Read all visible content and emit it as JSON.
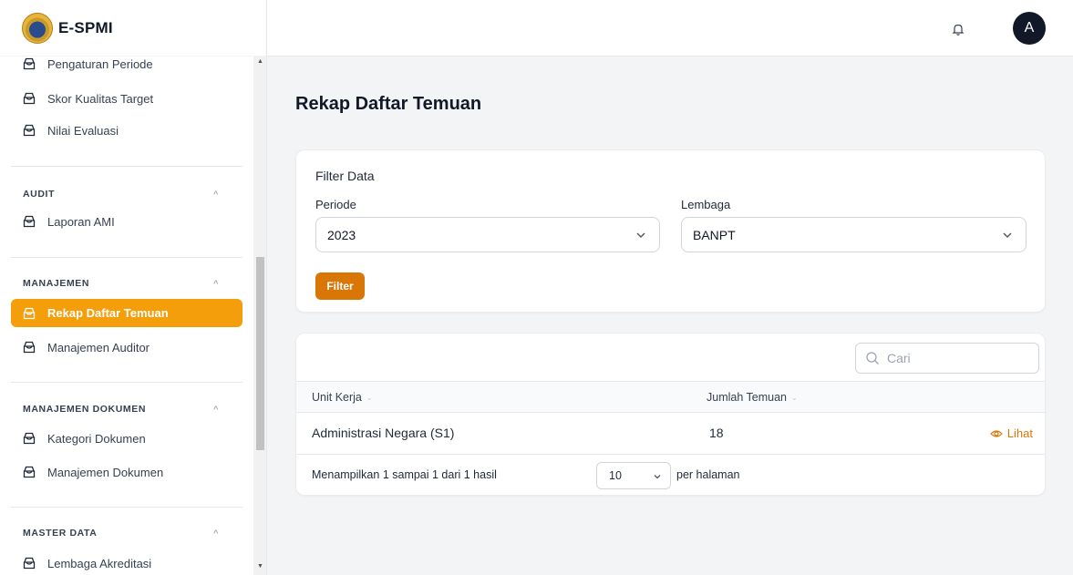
{
  "app": {
    "name": "E-SPMI"
  },
  "header": {
    "avatar_initial": "A"
  },
  "sidebar": {
    "top_items": [
      {
        "label": "Pengaturan Periode"
      },
      {
        "label": "Skor Kualitas Target"
      },
      {
        "label": "Nilai Evaluasi"
      }
    ],
    "sections": [
      {
        "title": "AUDIT",
        "items": [
          {
            "label": "Laporan AMI"
          }
        ]
      },
      {
        "title": "MANAJEMEN",
        "items": [
          {
            "label": "Rekap Daftar Temuan",
            "active": true
          },
          {
            "label": "Manajemen Auditor"
          }
        ]
      },
      {
        "title": "MANAJEMEN DOKUMEN",
        "items": [
          {
            "label": "Kategori Dokumen"
          },
          {
            "label": "Manajemen Dokumen"
          }
        ]
      },
      {
        "title": "MASTER DATA",
        "items": [
          {
            "label": "Lembaga Akreditasi"
          }
        ]
      }
    ]
  },
  "page": {
    "title": "Rekap Daftar Temuan"
  },
  "filter": {
    "heading": "Filter Data",
    "periode_label": "Periode",
    "periode_value": "2023",
    "lembaga_label": "Lembaga",
    "lembaga_value": "BANPT",
    "button_label": "Filter"
  },
  "table": {
    "search_placeholder": "Cari",
    "columns": [
      "Unit Kerja",
      "Jumlah Temuan"
    ],
    "rows": [
      {
        "unit_kerja": "Administrasi Negara (S1)",
        "jumlah_temuan": "18",
        "action": "Lihat"
      }
    ],
    "summary": "Menampilkan 1 sampai 1 dari 1 hasil",
    "per_page_value": "10",
    "per_page_label": "per halaman"
  },
  "colors": {
    "accent": "#f59e0b",
    "button": "#d97706",
    "avatar_bg": "#111827"
  }
}
